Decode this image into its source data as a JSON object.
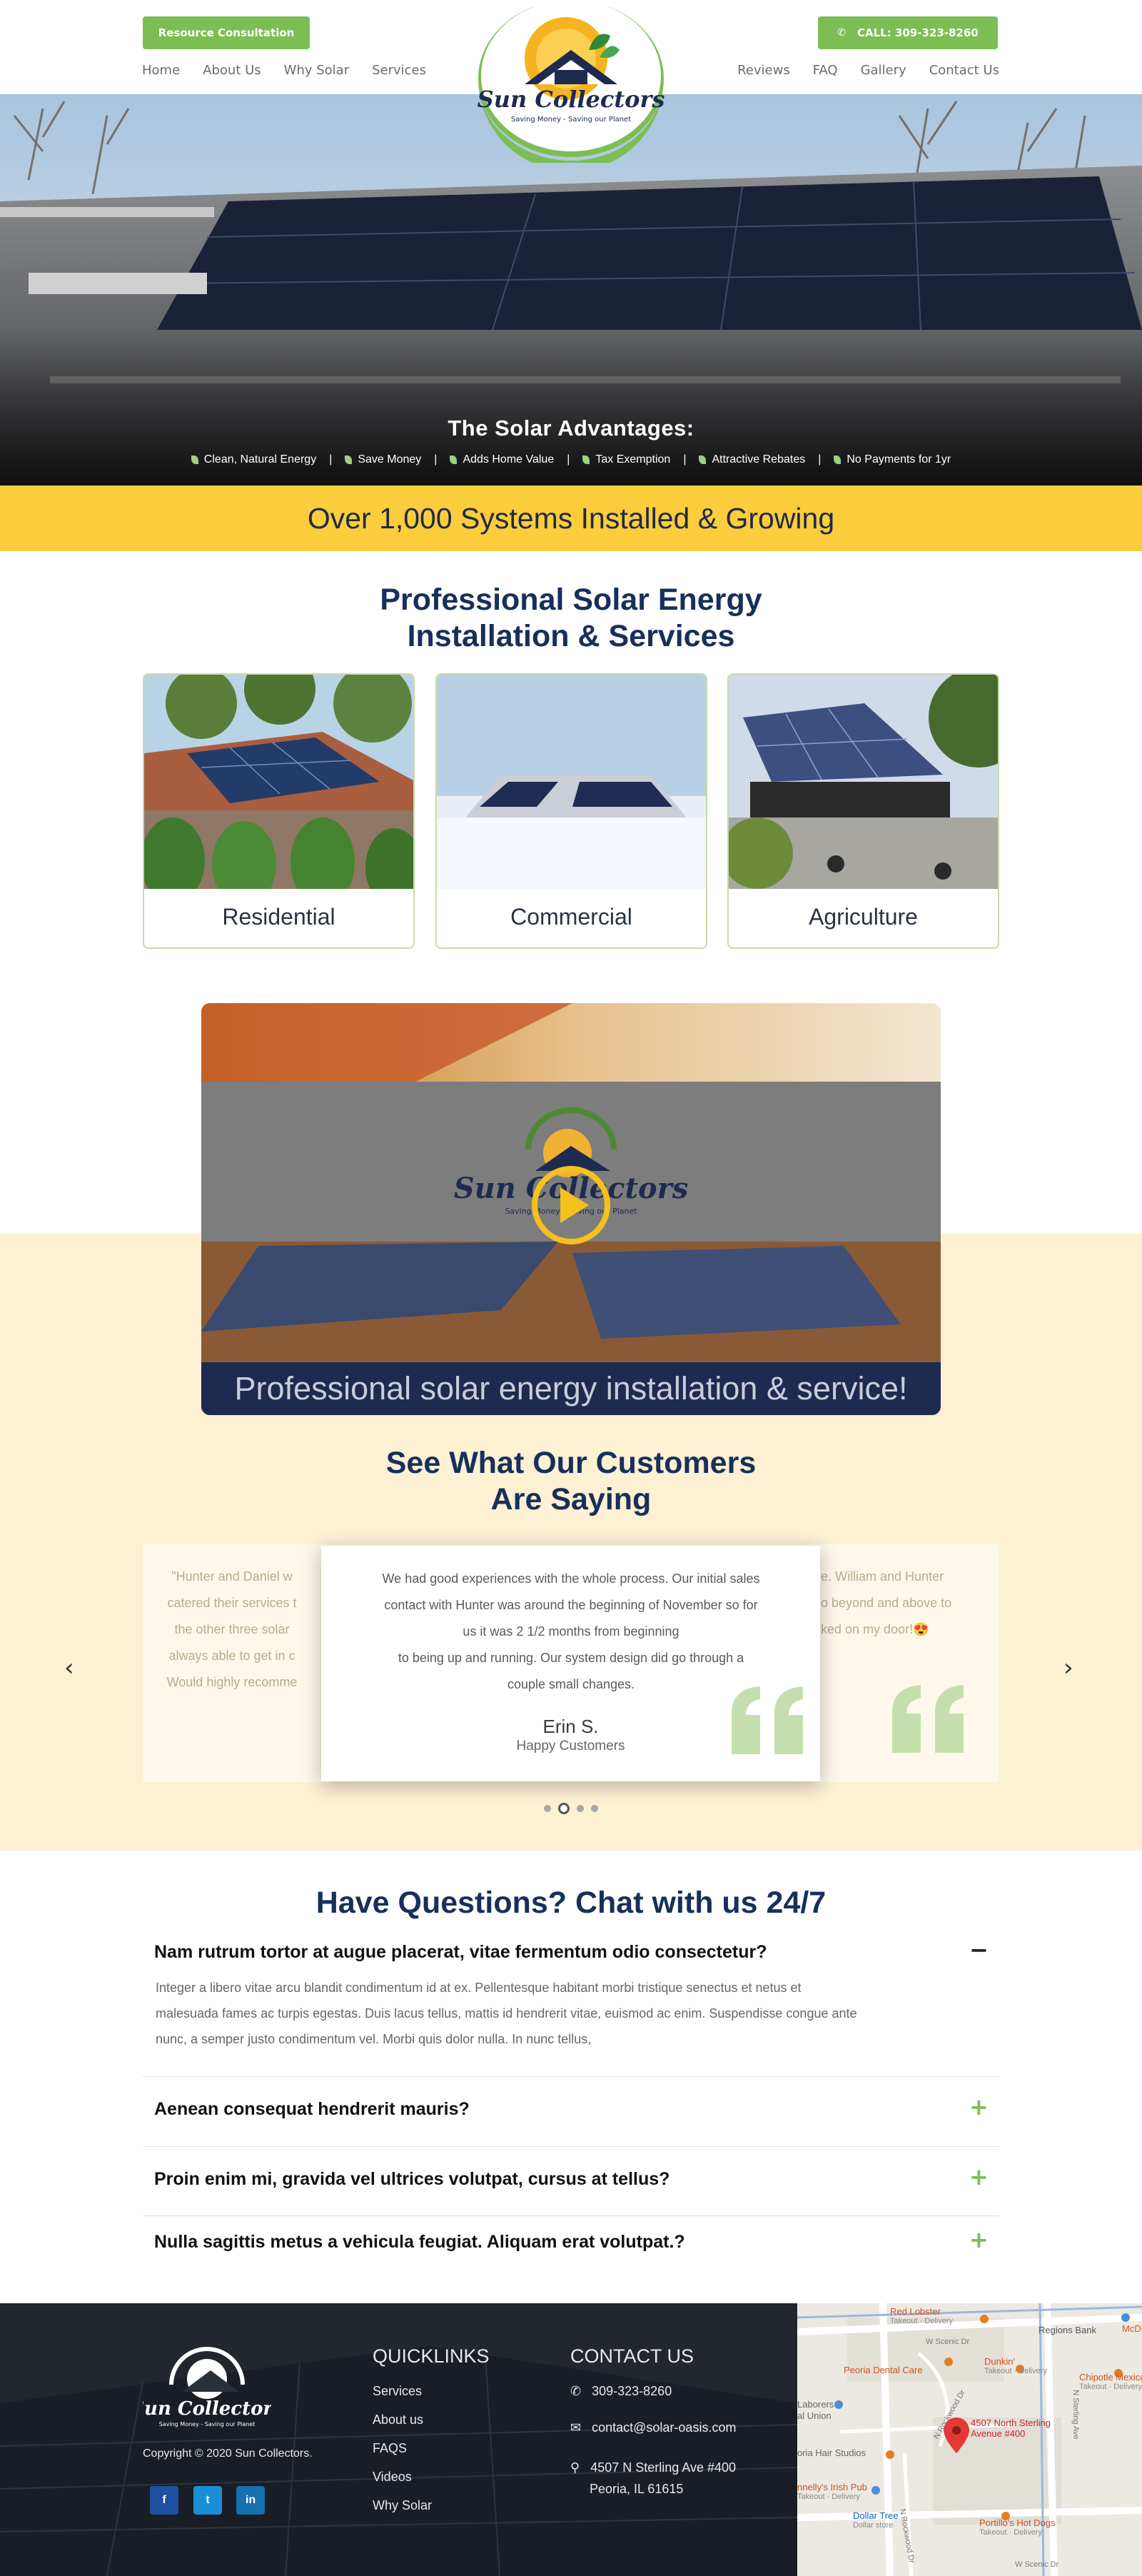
{
  "header": {
    "consult_label": "Resource Consultation",
    "call_label": "CALL:  309-323-8260",
    "nav_left": [
      "Home",
      "About Us",
      "Why Solar",
      "Services"
    ],
    "nav_right": [
      "Reviews",
      "FAQ",
      "Gallery",
      "Contact Us"
    ],
    "logo_name": "Sun Collectors",
    "logo_tagline": "Saving Money - Saving our Planet"
  },
  "hero": {
    "title": "The Solar Advantages:",
    "advantages": [
      "Clean, Natural Energy",
      "Save Money",
      "Adds Home Value",
      "Tax Exemption",
      "Attractive Rebates",
      "No Payments for 1yr"
    ],
    "separator": "|"
  },
  "band": {
    "text": "Over 1,000 Systems Installed & Growing"
  },
  "services": {
    "title_line1": "Professional Solar Energy",
    "title_line2": "Installation & Services",
    "cards": [
      {
        "label": "Residential"
      },
      {
        "label": "Commercial"
      },
      {
        "label": "Agriculture"
      }
    ]
  },
  "video": {
    "caption": "Professional solar energy installation & service!",
    "logo_name": "Sun Collectors",
    "logo_tagline": "Saving Money - Saving our Planet"
  },
  "testimonials": {
    "title_line1": "See What Our Customers",
    "title_line2": "Are Saying",
    "left_ghost": [
      "\"Hunter and Daniel w",
      "catered their services t",
      "the other three solar",
      "always able to get in c",
      "Would highly recomme"
    ],
    "right_ghost": [
      "e. William and Hunter",
      "o beyond and above to",
      "ked on my door!😍"
    ],
    "active": {
      "body_lines": [
        "We had good experiences with the whole process. Our initial sales",
        "contact with Hunter was around the beginning of November so for",
        "us it was 2 1/2 months from beginning",
        "to being up and running. Our system design did go through a",
        "couple small changes."
      ],
      "name": "Erin S.",
      "role": "Happy Customers"
    },
    "prev_icon": "‹",
    "next_icon": "›"
  },
  "faq": {
    "title": "Have Questions? Chat with us 24/7",
    "items": [
      {
        "question": "Nam rutrum tortor at augue placerat, vitae fermentum odio consectetur?",
        "toggle": "−",
        "answer_lines": [
          "Integer a libero vitae arcu blandit condimentum id at ex. Pellentesque habitant morbi tristique senectus et netus et",
          "malesuada fames ac turpis egestas. Duis lacus tellus, mattis id hendrerit vitae, euismod ac enim. Suspendisse congue ante",
          "nunc, a semper justo condimentum vel. Morbi quis dolor nulla. In nunc tellus,"
        ]
      },
      {
        "question": "Aenean consequat hendrerit mauris?",
        "toggle": "+"
      },
      {
        "question": "Proin enim mi, gravida vel ultrices volutpat, cursus at tellus?",
        "toggle": "+"
      },
      {
        "question": "Nulla sagittis metus a vehicula feugiat. Aliquam erat volutpat.?",
        "toggle": "+"
      }
    ]
  },
  "footer": {
    "logo_name": "Sun Collectors",
    "logo_tagline": "Saving Money - Saving our Planet",
    "copyright": "Copyright © 2020 Sun Collectors.",
    "social": [
      "f",
      "t",
      "in"
    ],
    "quicklinks_title": "QUICKLINKS",
    "quicklinks": [
      "Services",
      "About us",
      "FAQS",
      "Videos",
      "Why Solar"
    ],
    "contact_title": "CONTACT US",
    "phone": "309-323-8260",
    "email": "contact@solar-oasis.com",
    "address_line1": "4507 N Sterling Ave #400",
    "address_line2": "Peoria, IL 61615"
  },
  "map": {
    "pin_label_line1": "4507 North Sterling",
    "pin_label_line2": "Avenue #400",
    "places": [
      {
        "name": "Red Lobster",
        "sub": "Takeout · Delivery"
      },
      {
        "name": "Regions Bank",
        "sub": ""
      },
      {
        "name": "Peoria Dental Care",
        "sub": ""
      },
      {
        "name": "Dunkin'",
        "sub": "Takeout · Delivery"
      },
      {
        "name": "Chipotle Mexican",
        "sub": "Takeout · Delivery"
      },
      {
        "name": "Laborers",
        "sub": ""
      },
      {
        "name": "al Union",
        "sub": ""
      },
      {
        "name": "oria Hair Studios",
        "sub": ""
      },
      {
        "name": "nnelly's Irish Pub",
        "sub": "Takeout · Delivery"
      },
      {
        "name": "Dollar Tree",
        "sub": "Dollar store"
      },
      {
        "name": "Portillo's Hot Dogs",
        "sub": "Takeout · Delivery"
      },
      {
        "name": "McD",
        "sub": ""
      }
    ],
    "streets": [
      "W Scenic Dr",
      "N Sterling Ave",
      "N Rockwood Dr",
      "N Rockwood Dr",
      "W Scenic Dr"
    ]
  }
}
